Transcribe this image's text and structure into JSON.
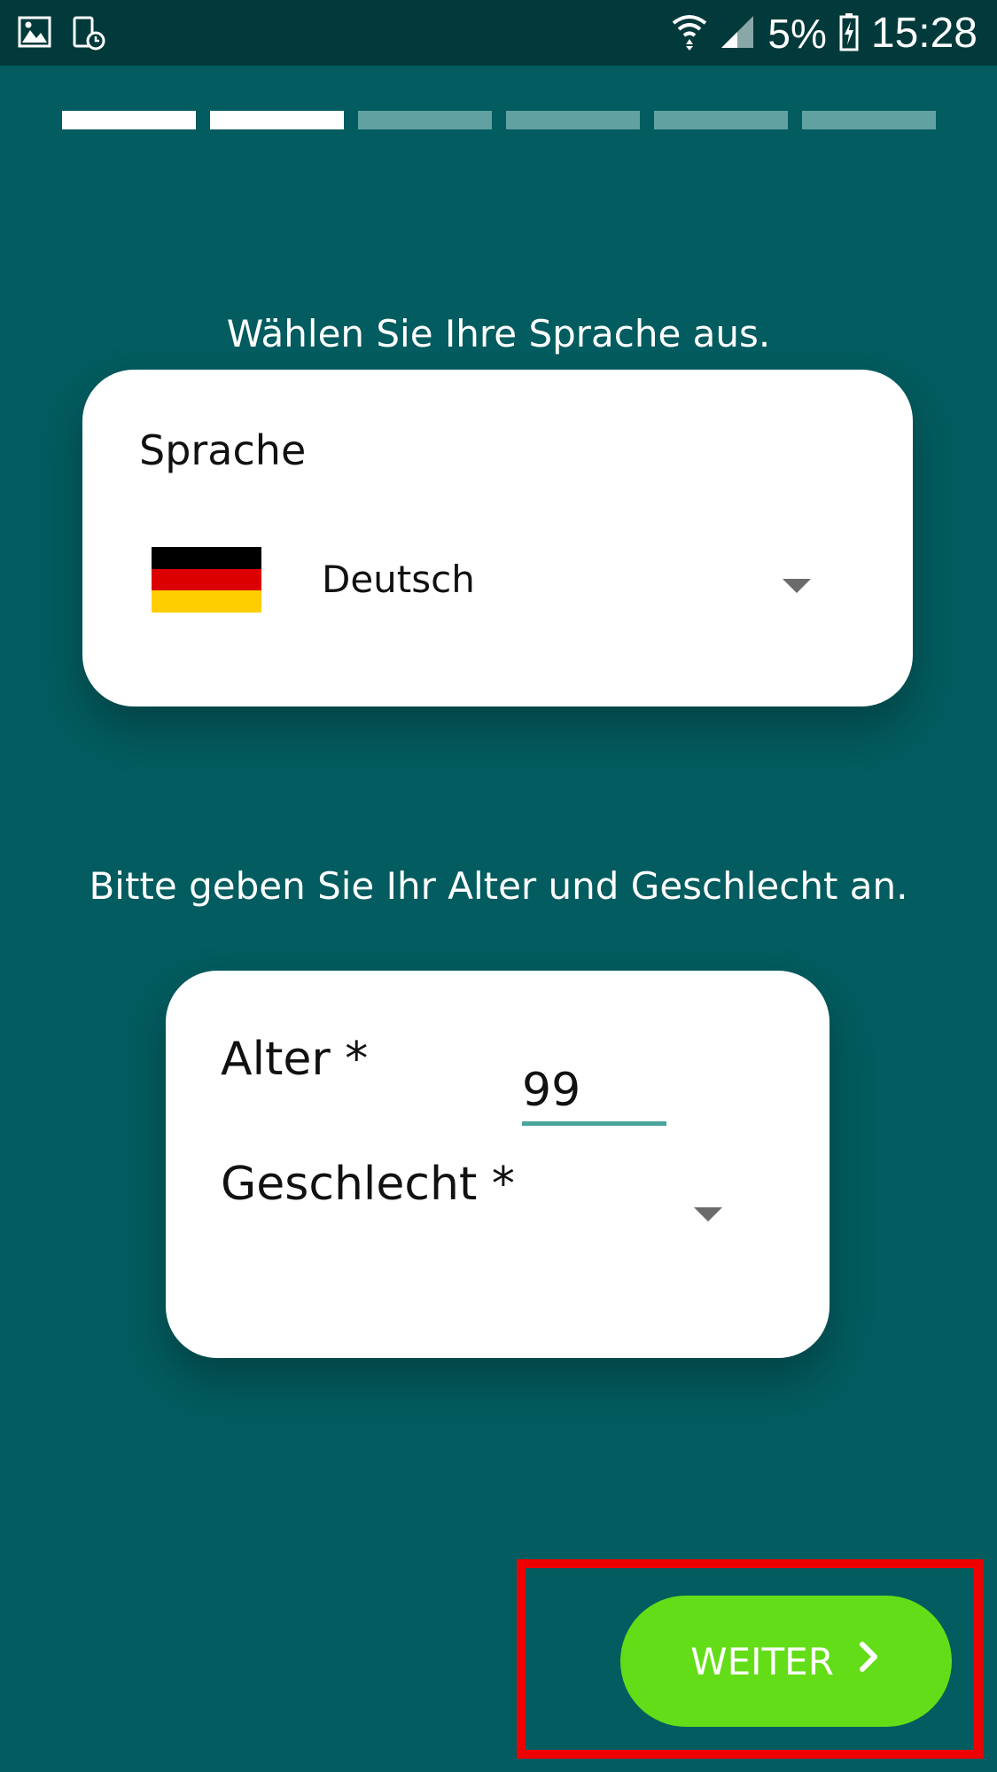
{
  "status_bar": {
    "left_icons": [
      "gallery-icon",
      "screenshot-timer-icon"
    ],
    "right_icons": [
      "wifi-icon",
      "signal-icon",
      "battery-charging-icon"
    ],
    "battery": "5%",
    "time": "15:28"
  },
  "progress": {
    "total_steps": 6,
    "completed_steps": 2
  },
  "language_section": {
    "prompt": "Wählen Sie Ihre Sprache aus.",
    "label": "Sprache",
    "selected_value": "Deutsch",
    "flag_colors": [
      "#000000",
      "#dd0000",
      "#ffce00"
    ],
    "flag_icon": "germany-flag-icon",
    "dropdown_icon": "caret-down-icon"
  },
  "demographics_section": {
    "prompt": "Bitte geben Sie Ihr Alter und Geschlecht an.",
    "age_label": "Alter *",
    "age_value": "99",
    "gender_label": "Geschlecht *",
    "dropdown_icon": "caret-down-icon"
  },
  "footer": {
    "next_label": "WEITER",
    "next_icon": "chevron-right-icon"
  },
  "colors": {
    "background": "#035c5f",
    "status_bar": "#023a3b",
    "progress_active": "#ffffff",
    "progress_inactive": "#62a1a1",
    "next_button": "#63dd17",
    "input_underline": "#4aa59b",
    "highlight": "#ee0000"
  }
}
